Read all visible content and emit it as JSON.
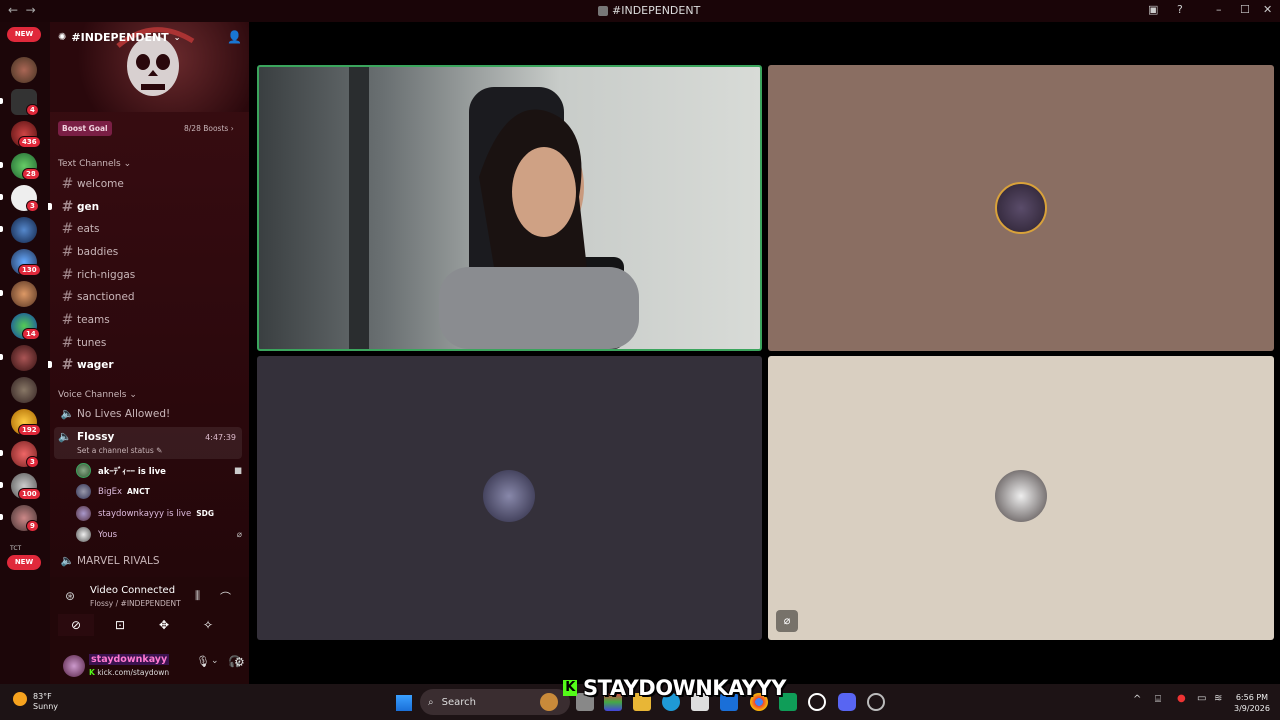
{
  "window": {
    "title": "#INDEPENDENT"
  },
  "server": {
    "name": "#INDEPENDENT",
    "boost_goal": "Boost Goal",
    "boosts": "8/28 Boosts"
  },
  "rail": {
    "new_top": "NEW",
    "new_bottom": "NEW",
    "badges": [
      "4",
      "436",
      "28",
      "3",
      "130",
      "14",
      "192",
      "3",
      "100",
      "9"
    ],
    "tag_label": "TCT"
  },
  "text_category": "Text Channels",
  "text_channels": [
    {
      "name": "welcome"
    },
    {
      "name": "gen"
    },
    {
      "name": "eats"
    },
    {
      "name": "baddies"
    },
    {
      "name": "rich-niggas"
    },
    {
      "name": "sanctioned"
    },
    {
      "name": "teams"
    },
    {
      "name": "tunes"
    },
    {
      "name": "wager"
    }
  ],
  "voice_category": "Voice Channels",
  "voice_channels": {
    "first": "No Lives Allowed!",
    "active": {
      "name": "Flossy",
      "timer": "4:47:39",
      "status": "Set a channel status"
    },
    "users": [
      {
        "name": "akｰﾃﾞｨｰｰ is live",
        "tag": ""
      },
      {
        "name": "BigEx",
        "tag": "ANCT"
      },
      {
        "name": "staydownkayyy is live",
        "tag": "SDG"
      },
      {
        "name": "Yous",
        "tag": ""
      }
    ],
    "last": "MARVEL RIVALS"
  },
  "connection": {
    "status": "Video Connected",
    "location": "Flossy / #INDEPENDENT"
  },
  "me": {
    "name": "staydownkayy",
    "status": "kick.com/staydown"
  },
  "weather": {
    "temp": "83°F",
    "cond": "Sunny"
  },
  "taskbar": {
    "search": "Search"
  },
  "clock": {
    "time": "6:56 PM",
    "date": "3/9/2026"
  },
  "overlay": {
    "k": "K",
    "text": "STAYDOWNKAYYY"
  },
  "colors": {
    "accent": "#e0293b",
    "tile_speaking_border": "#3ba55d",
    "tile2": "#8a6e62",
    "tile3": "#34303a",
    "tile4": "#d9cfc1"
  }
}
